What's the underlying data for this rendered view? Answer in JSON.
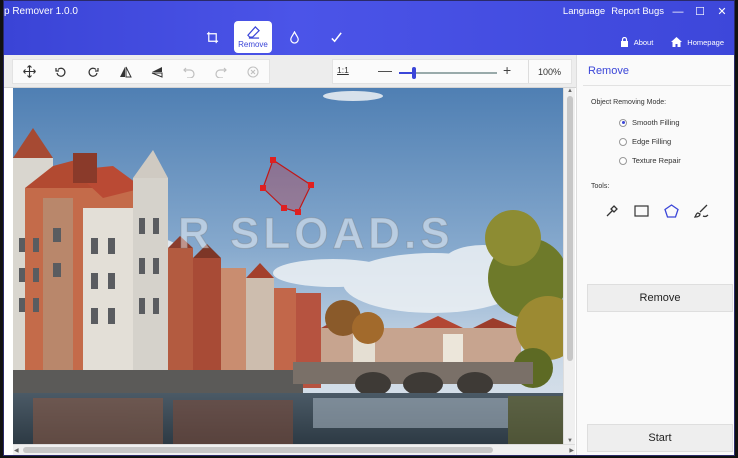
{
  "window": {
    "title": "p Remover 1.0.0",
    "language": "Language",
    "report_bugs": "Report Bugs",
    "minimize": "—",
    "maximize": "☐",
    "close": "✕"
  },
  "tabs": [
    {
      "name": "crop"
    },
    {
      "name": "remove",
      "label": "Remove"
    },
    {
      "name": "drop"
    },
    {
      "name": "check"
    }
  ],
  "nav": {
    "about": "About",
    "homepage": "Homepage"
  },
  "zoom": {
    "ratio": "1:1",
    "minus": "—",
    "plus": "+",
    "percent": "100%",
    "level": 0.15
  },
  "panel": {
    "title": "Remove",
    "mode_label": "Object Removing Mode:",
    "modes": [
      {
        "label": "Smooth Filling",
        "selected": true
      },
      {
        "label": "Edge Filling",
        "selected": false
      },
      {
        "label": "Texture Repair",
        "selected": false
      }
    ],
    "tools_label": "Tools:",
    "remove_button": "Remove",
    "start_button": "Start"
  },
  "watermark": "R SLOAD.S",
  "colors": {
    "accent": "#3b46d8",
    "selection": "#e02020"
  }
}
